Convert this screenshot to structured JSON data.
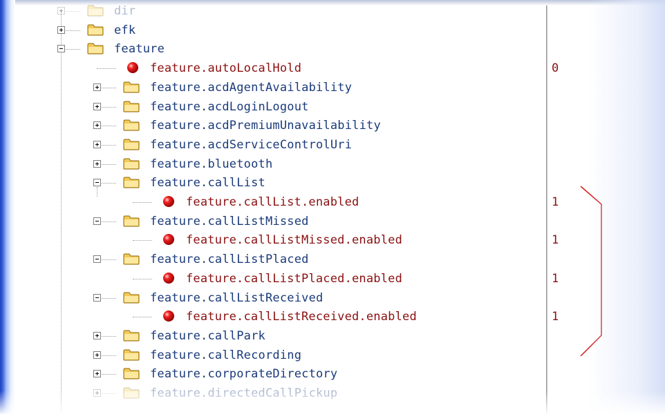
{
  "tree": {
    "items": [
      {
        "label": "dir",
        "type": "folder",
        "state": "plus",
        "level": 0,
        "faded": true
      },
      {
        "label": "efk",
        "type": "folder",
        "state": "plus",
        "level": 0
      },
      {
        "label": "feature",
        "type": "folder",
        "state": "minus",
        "level": 0
      },
      {
        "label": "feature.autoLocalHold",
        "type": "leaf",
        "level": 1,
        "value": "0"
      },
      {
        "label": "feature.acdAgentAvailability",
        "type": "folder",
        "state": "plus",
        "level": 1
      },
      {
        "label": "feature.acdLoginLogout",
        "type": "folder",
        "state": "plus",
        "level": 1
      },
      {
        "label": "feature.acdPremiumUnavailability",
        "type": "folder",
        "state": "plus",
        "level": 1
      },
      {
        "label": "feature.acdServiceControlUri",
        "type": "folder",
        "state": "plus",
        "level": 1
      },
      {
        "label": "feature.bluetooth",
        "type": "folder",
        "state": "plus",
        "level": 1
      },
      {
        "label": "feature.callList",
        "type": "folder",
        "state": "minus",
        "level": 1
      },
      {
        "label": "feature.callList.enabled",
        "type": "leaf",
        "level": 2,
        "value": "1"
      },
      {
        "label": "feature.callListMissed",
        "type": "folder",
        "state": "minus",
        "level": 1
      },
      {
        "label": "feature.callListMissed.enabled",
        "type": "leaf",
        "level": 2,
        "value": "1"
      },
      {
        "label": "feature.callListPlaced",
        "type": "folder",
        "state": "minus",
        "level": 1
      },
      {
        "label": "feature.callListPlaced.enabled",
        "type": "leaf",
        "level": 2,
        "value": "1"
      },
      {
        "label": "feature.callListReceived",
        "type": "folder",
        "state": "minus",
        "level": 1
      },
      {
        "label": "feature.callListReceived.enabled",
        "type": "leaf",
        "level": 2,
        "value": "1"
      },
      {
        "label": "feature.callPark",
        "type": "folder",
        "state": "plus",
        "level": 1
      },
      {
        "label": "feature.callRecording",
        "type": "folder",
        "state": "plus",
        "level": 1
      },
      {
        "label": "feature.corporateDirectory",
        "type": "folder",
        "state": "plus",
        "level": 1
      },
      {
        "label": "feature.directedCallPickup",
        "type": "folder",
        "state": "plus",
        "level": 1,
        "faded": true
      }
    ]
  },
  "icons": {
    "folder": "folder-icon",
    "leaf": "red-bullet-icon",
    "expand": "plus-box-icon",
    "collapse": "minus-box-icon"
  },
  "colors": {
    "node_text": "#1a3a7a",
    "leaf_text": "#8b1010",
    "value_text": "#8b1010",
    "annotation_bracket": "#d21e1e"
  }
}
